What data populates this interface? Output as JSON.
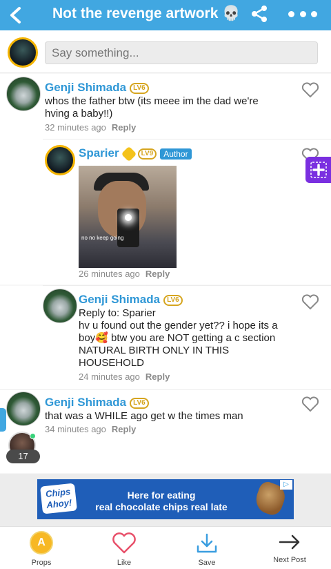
{
  "header": {
    "title": "Not the revenge artwork 💀"
  },
  "compose": {
    "placeholder": "Say something..."
  },
  "comments": [
    {
      "username": "Genji Shimada",
      "level": "LV6",
      "text": "whos the father btw (its meee im the dad we're hving a baby!!)",
      "time": "32 minutes ago",
      "reply_label": "Reply"
    },
    {
      "username": "Sparier",
      "level": "LV9",
      "author_tag": "Author",
      "image_caption": "no no keep going",
      "time": "26 minutes ago",
      "reply_label": "Reply"
    },
    {
      "username": "Genji Shimada",
      "level": "LV6",
      "reply_to": "Reply to: Sparier",
      "text": "hv u found out the gender yet?? i hope its a boy🥰  btw you are NOT getting a c section NATURAL BIRTH ONLY IN THIS HOUSEHOLD",
      "time": "24 minutes ago",
      "reply_label": "Reply"
    },
    {
      "username": "Genji Shimada",
      "level": "LV6",
      "text": "that was a WHILE ago get w the times man",
      "time": "34 minutes ago",
      "reply_label": "Reply"
    }
  ],
  "floating": {
    "online_count": "17"
  },
  "ad": {
    "logo": "Chips Ahoy!",
    "line1": "Here for eating",
    "line2": "real chocolate chips real late"
  },
  "bottom_bar": {
    "props": "Props",
    "like": "Like",
    "save": "Save",
    "next": "Next Post"
  },
  "colors": {
    "header": "#41a7e1",
    "username": "#2f97d6",
    "plus_button": "#7a2fe0",
    "like_heart": "#e8506a",
    "save_icon": "#3a9ee0"
  }
}
